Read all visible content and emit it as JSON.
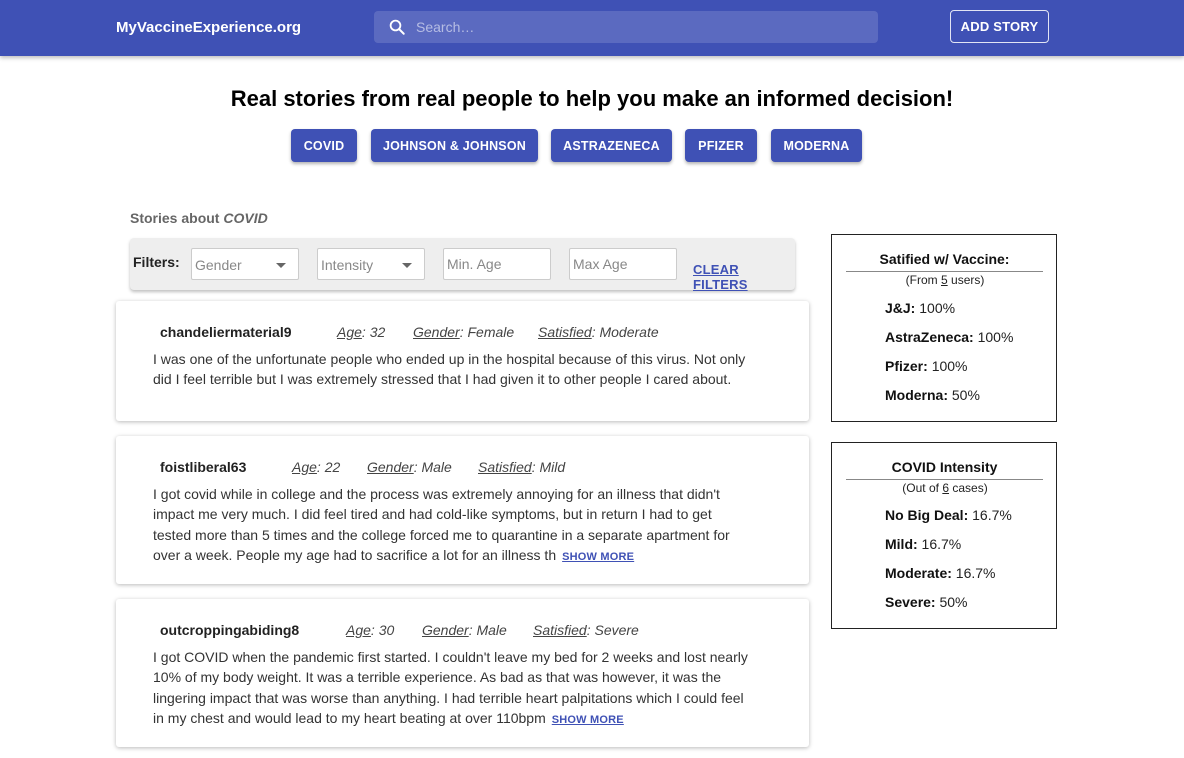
{
  "header": {
    "brand": "MyVaccineExperience.org",
    "search_placeholder": "Search…",
    "add_story": "ADD STORY"
  },
  "headline": "Real stories from real people to help you make an informed decision!",
  "vaccine_buttons": [
    "COVID",
    "JOHNSON & JOHNSON",
    "ASTRAZENECA",
    "PFIZER",
    "MODERNA"
  ],
  "stories_label": {
    "prefix": "Stories about",
    "topic": "COVID"
  },
  "filters": {
    "label": "Filters:",
    "gender_placeholder": "Gender",
    "intensity_placeholder": "Intensity",
    "min_age_placeholder": "Min. Age",
    "max_age_placeholder": "Max Age",
    "clear": "CLEAR FILTERS"
  },
  "field_labels": {
    "age": "Age",
    "gender": "Gender",
    "satisfied": "Satisfied"
  },
  "stories": [
    {
      "user": "chandeliermaterial9",
      "age": "32",
      "gender": "Female",
      "satisfied": "Moderate",
      "text": "I was one of the unfortunate people who ended up in the hospital because of this virus. Not only did I feel terrible but I was extremely stressed that I had given it to other people I cared about.",
      "show_more": ""
    },
    {
      "user": "foistliberal63",
      "age": "22",
      "gender": "Male",
      "satisfied": "Mild",
      "text": "I got covid while in college and the process was extremely annoying for an illness that didn't impact me very much. I did feel tired and had cold-like symptoms, but in return I had to get tested more than 5 times and the college forced me to quarantine in a separate apartment for over a week. People my age had to sacrifice a lot for an illness th",
      "show_more": "SHOW MORE"
    },
    {
      "user": "outcroppingabiding8",
      "age": "30",
      "gender": "Male",
      "satisfied": "Severe",
      "text": "I got COVID when the pandemic first started. I couldn't leave my bed for 2 weeks and lost nearly 10% of my body weight. It was a terrible experience. As bad as that was however, it was the lingering impact that was worse than anything. I had terrible heart palpitations which I could feel in my chest and would lead to my heart beating at over 110bpm",
      "show_more": "SHOW MORE"
    }
  ],
  "satisfied_panel": {
    "title": "Satified w/ Vaccine:",
    "sub_prefix": "(From",
    "sub_count": "5",
    "sub_suffix": "users)",
    "rows": [
      {
        "label": "J&J:",
        "value": "100%"
      },
      {
        "label": "AstraZeneca:",
        "value": "100%"
      },
      {
        "label": "Pfizer:",
        "value": "100%"
      },
      {
        "label": "Moderna:",
        "value": "50%"
      }
    ]
  },
  "intensity_panel": {
    "title": "COVID Intensity",
    "sub_prefix": "(Out of",
    "sub_count": "6",
    "sub_suffix": "cases)",
    "rows": [
      {
        "label": "No Big Deal:",
        "value": "16.7%"
      },
      {
        "label": "Mild:",
        "value": "16.7%"
      },
      {
        "label": "Moderate:",
        "value": "16.7%"
      },
      {
        "label": "Severe:",
        "value": "50%"
      }
    ]
  }
}
